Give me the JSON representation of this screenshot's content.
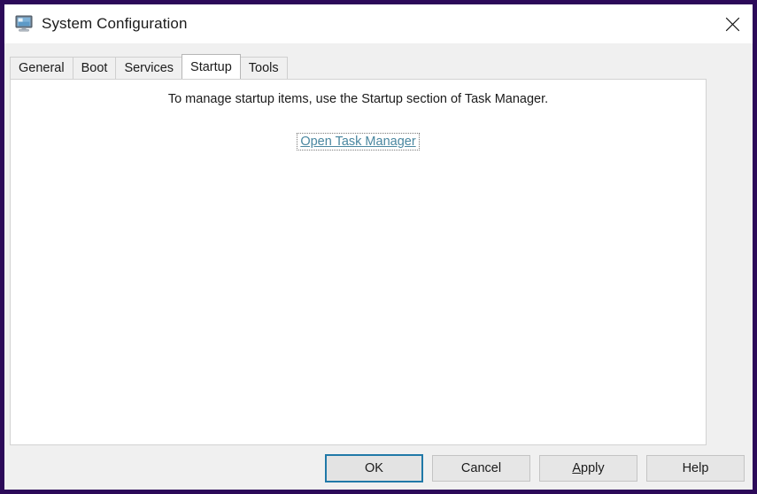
{
  "window": {
    "title": "System Configuration",
    "icon": "system-configuration-icon",
    "frame_color": "#2c0a59",
    "titlebar_background": "#ffffff",
    "dialog_background": "#f0f0f0",
    "close_label": "Close",
    "close_icon": "close-icon"
  },
  "tabs": [
    {
      "label": "General",
      "active": false
    },
    {
      "label": "Boot",
      "active": false
    },
    {
      "label": "Services",
      "active": false
    },
    {
      "label": "Startup",
      "active": true
    },
    {
      "label": "Tools",
      "active": false
    }
  ],
  "startup_panel": {
    "info_text": "To manage startup items, use the Startup section of Task Manager.",
    "link_label": "Open Task Manager",
    "link_color": "#4a87a0",
    "link_focused": true
  },
  "buttons": [
    {
      "label": "OK",
      "accel": "",
      "focused": true
    },
    {
      "label": "Cancel",
      "accel": "",
      "focused": false
    },
    {
      "label": "Apply",
      "accel": "A",
      "focused": false
    },
    {
      "label": "Help",
      "accel": "",
      "focused": false
    }
  ],
  "accent_colors": {
    "focus_border": "#2079a8",
    "window_border": "#2c0a59",
    "link": "#4a87a0"
  }
}
